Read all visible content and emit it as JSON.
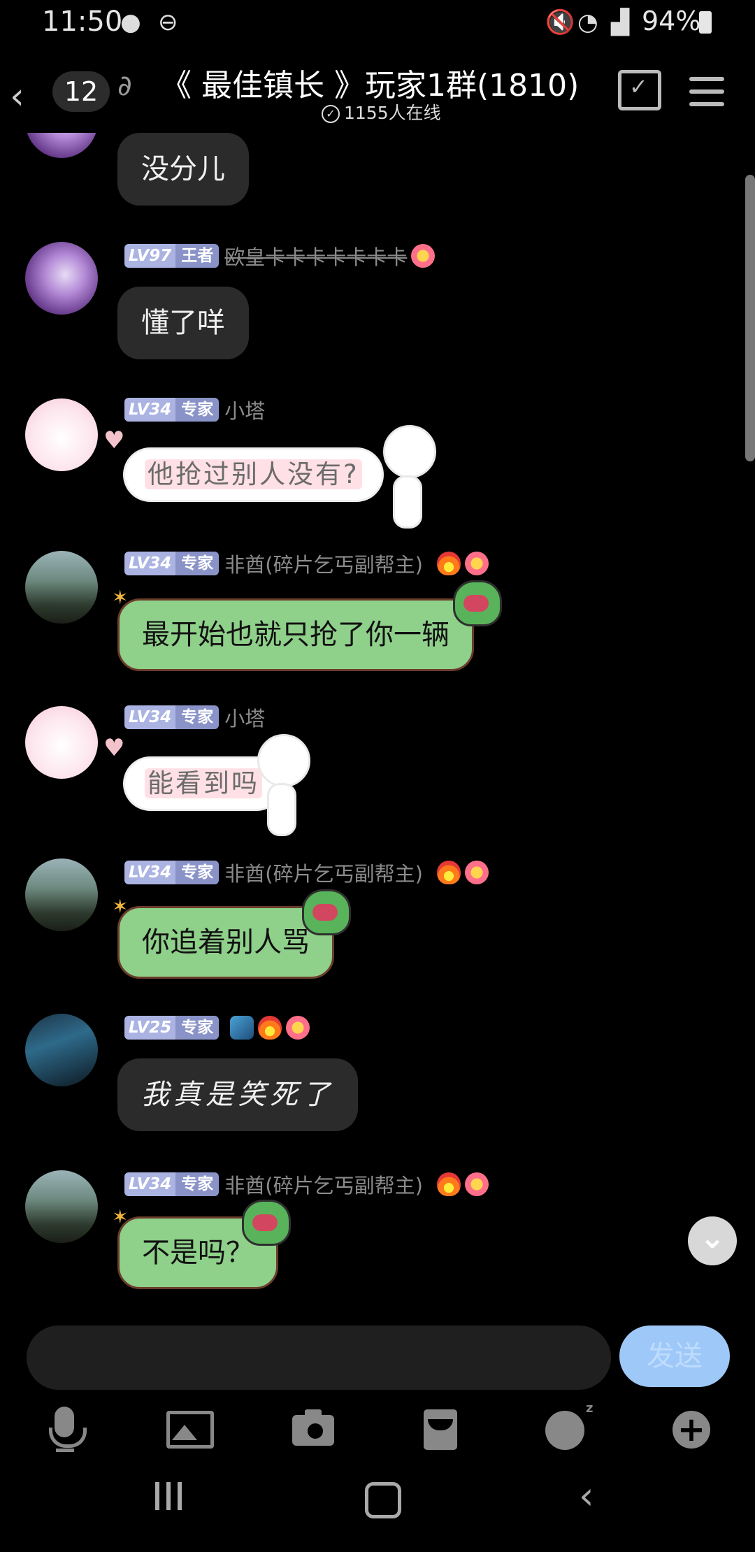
{
  "status": {
    "time": "11:50",
    "battery": "94%"
  },
  "header": {
    "unread": "12",
    "title": "《 最佳镇长 》玩家1群(1810)",
    "online": "1155人在线"
  },
  "messages": [
    {
      "id": 0,
      "text": "没分儿"
    },
    {
      "id": 1,
      "level": "LV97",
      "rank": "王者",
      "nick": "欧皇卡卡卡卡卡卡卡",
      "text": "懂了咩"
    },
    {
      "id": 2,
      "level": "LV34",
      "rank": "专家",
      "nick": "小塔",
      "text": "他抢过别人没有?"
    },
    {
      "id": 3,
      "level": "LV34",
      "rank": "专家",
      "nick": "非酋(碎片乞丐副帮主)",
      "text": "最开始也就只抢了你一辆"
    },
    {
      "id": 4,
      "level": "LV34",
      "rank": "专家",
      "nick": "小塔",
      "text": "能看到吗"
    },
    {
      "id": 5,
      "level": "LV34",
      "rank": "专家",
      "nick": "非酋(碎片乞丐副帮主)",
      "text": "你追着别人骂"
    },
    {
      "id": 6,
      "level": "LV25",
      "rank": "专家",
      "nick": "",
      "text": "我真是笑死了"
    },
    {
      "id": 7,
      "level": "LV34",
      "rank": "专家",
      "nick": "非酋(碎片乞丐副帮主)",
      "text": "不是吗？"
    }
  ],
  "composer": {
    "send_label": "发送"
  },
  "icons": [
    "back-arrow-icon",
    "ear-icon",
    "calendar-check-icon",
    "menu-icon",
    "mic-icon",
    "image-icon",
    "camera-icon",
    "red-envelope-icon",
    "sticker-icon",
    "plus-icon",
    "chevron-down-icon"
  ],
  "colors": {
    "green_bubble": "#8fd08a",
    "send_button": "#9ec8f7",
    "level_badge": "#aab3e2"
  }
}
